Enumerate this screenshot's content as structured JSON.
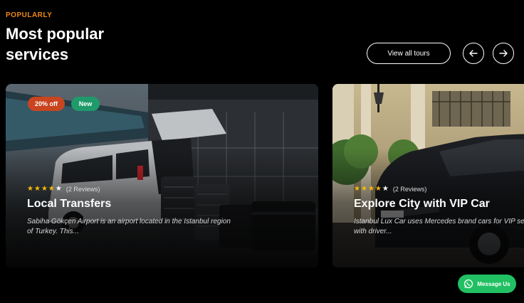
{
  "section": {
    "eyebrow": "POPULARLY",
    "title": "Most popular services"
  },
  "controls": {
    "view_all_label": "View all tours",
    "prev_icon": "arrow-left-icon",
    "next_icon": "arrow-right-icon"
  },
  "cards": [
    {
      "badges": [
        "20% off",
        "New"
      ],
      "stars": 4,
      "max_stars": 5,
      "reviews": "(2 Reviews)",
      "title": "Local Transfers",
      "description": "Sabiha Gökçen Airport is an airport located in the Istanbul region of Turkey. This..."
    },
    {
      "stars": 4,
      "max_stars": 5,
      "reviews": "(2 Reviews)",
      "title": "Explore City with VIP Car",
      "description": "Istanbul Lux Car uses Mercedes brand cars for VIP service with driver..."
    }
  ],
  "chat": {
    "label": "Message Us",
    "icon": "whatsapp-icon"
  },
  "colors": {
    "accent_orange": "#f08b16",
    "badge_sale": "#c8451f",
    "badge_new": "#1f9a6a",
    "star": "#f5b90b",
    "chat_green": "#21c063"
  }
}
